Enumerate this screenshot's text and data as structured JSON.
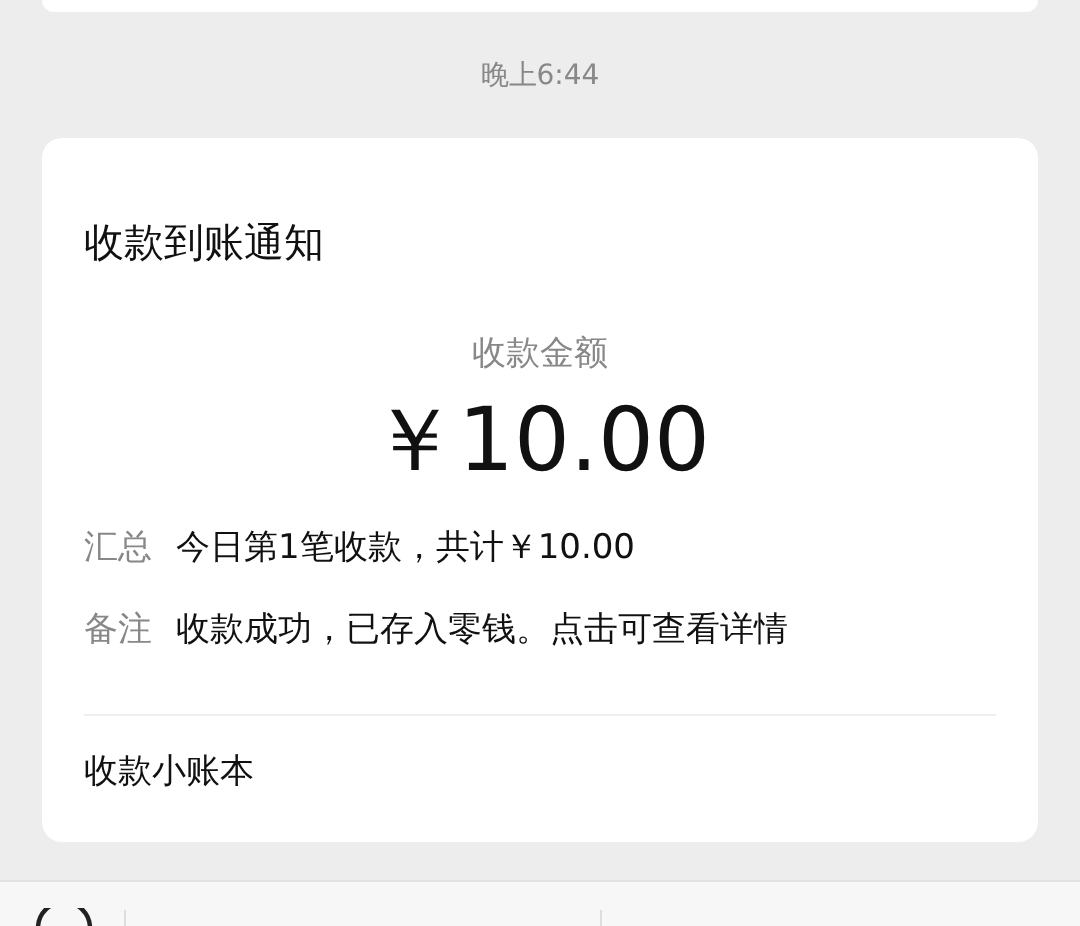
{
  "timestamp": "晚上6:44",
  "notice": {
    "title": "收款到账通知",
    "amount_label": "收款金额",
    "amount": "￥10.00",
    "fields": [
      {
        "label": "汇总",
        "value": "今日第1笔收款，共计￥10.00"
      },
      {
        "label": "备注",
        "value": "收款成功，已存入零钱。点击可查看详情"
      }
    ],
    "footer_link": "收款小账本"
  }
}
